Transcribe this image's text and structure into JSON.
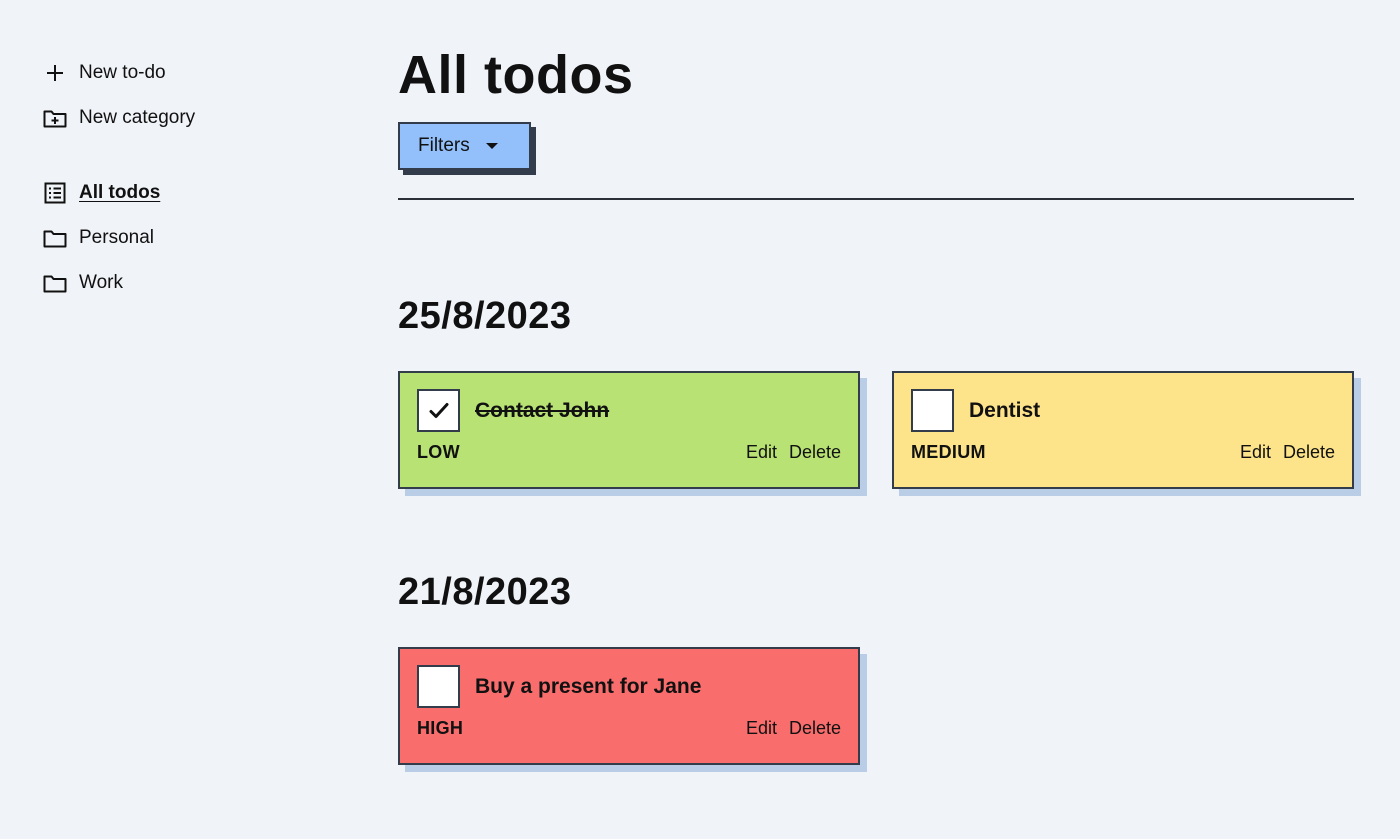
{
  "sidebar": {
    "actions": [
      {
        "label": "New to-do",
        "icon": "plus-icon"
      },
      {
        "label": "New category",
        "icon": "folder-plus-icon"
      }
    ],
    "nav": [
      {
        "label": "All todos",
        "icon": "list-icon",
        "active": true
      },
      {
        "label": "Personal",
        "icon": "folder-icon",
        "active": false
      },
      {
        "label": "Work",
        "icon": "folder-icon",
        "active": false
      }
    ]
  },
  "main": {
    "title": "All todos",
    "filters_label": "Filters",
    "groups": [
      {
        "date": "25/8/2023",
        "todos": [
          {
            "title": "Contact John",
            "priority": "LOW",
            "done": true,
            "color": "#b8e274",
            "edit": "Edit",
            "delete": "Delete"
          },
          {
            "title": "Dentist",
            "priority": "MEDIUM",
            "done": false,
            "color": "#fde38a",
            "edit": "Edit",
            "delete": "Delete"
          }
        ]
      },
      {
        "date": "21/8/2023",
        "todos": [
          {
            "title": "Buy a present for Jane",
            "priority": "HIGH",
            "done": false,
            "color": "#f96d6d",
            "edit": "Edit",
            "delete": "Delete"
          }
        ]
      }
    ]
  },
  "colors": {
    "background": "#f0f3f8",
    "filters_button": "#93c0fb",
    "border": "#333c4a",
    "card_shadow": "#b9cee6"
  }
}
